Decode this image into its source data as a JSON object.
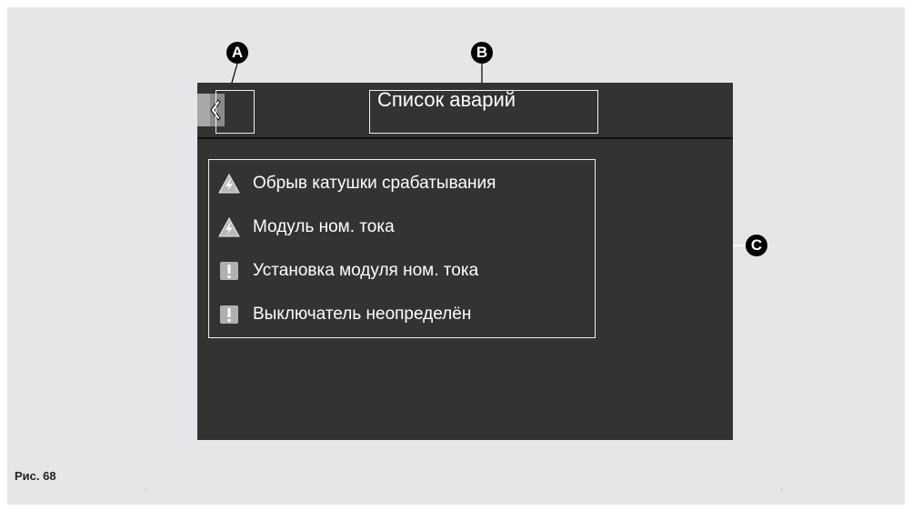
{
  "screen": {
    "title": "Список аварий",
    "back_icon": "chevron-left-icon"
  },
  "alarms": [
    {
      "label": "Обрыв катушки срабатывания",
      "icon": "lightning-warning-icon"
    },
    {
      "label": "Модуль ном. тока",
      "icon": "lightning-warning-icon"
    },
    {
      "label": "Установка модуля ном. тока",
      "icon": "exclamation-icon"
    },
    {
      "label": "Выключатель неопределён",
      "icon": "exclamation-icon"
    }
  ],
  "markers": {
    "a": "A",
    "b": "B",
    "c": "C"
  },
  "caption": "Рис. 68"
}
